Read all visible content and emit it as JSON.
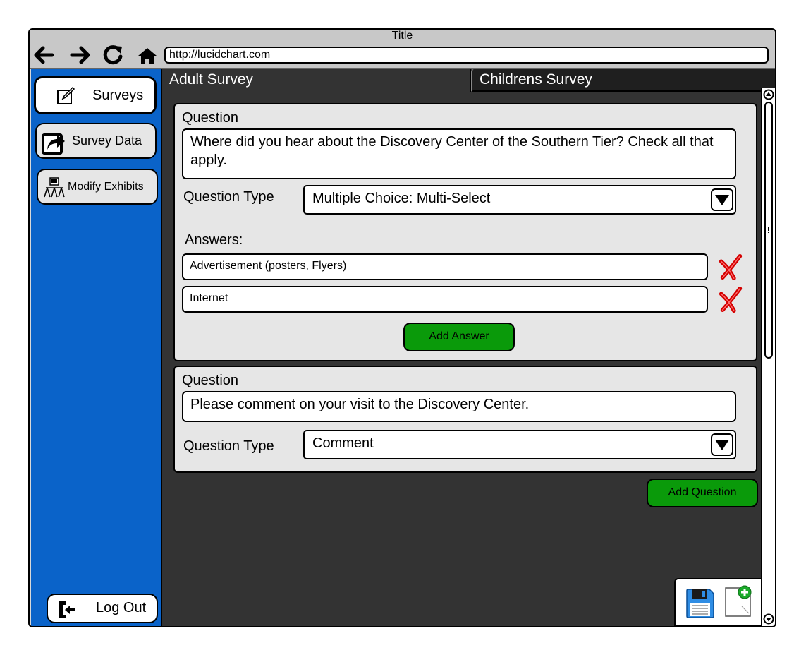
{
  "window": {
    "title": "Title",
    "url": "http://lucidchart.com"
  },
  "nav": {
    "back_icon": "arrow-left-icon",
    "forward_icon": "arrow-right-icon",
    "reload_icon": "reload-icon",
    "home_icon": "home-icon"
  },
  "sidebar": {
    "items": [
      {
        "label": "Surveys",
        "icon": "edit-icon",
        "selected": true
      },
      {
        "label": "Survey Data",
        "icon": "share-icon",
        "selected": false
      },
      {
        "label": "Modify Exhibits",
        "icon": "exhibit-icon",
        "selected": false
      }
    ],
    "logout_label": "Log Out"
  },
  "tabs": [
    {
      "label": "Adult Survey",
      "active": true
    },
    {
      "label": "Childrens Survey",
      "active": false
    }
  ],
  "questions": [
    {
      "label": "Question",
      "text": "Where did you hear about the Discovery Center of the Southern Tier? Check all that apply.",
      "type_label": "Question Type",
      "type_value": "Multiple Choice: Multi-Select",
      "answers_label": "Answers:",
      "answers": [
        "Advertisement (posters, Flyers)",
        "Internet"
      ],
      "add_answer_label": "Add Answer"
    },
    {
      "label": "Question",
      "text": "Please comment on your visit to the Discovery Center.",
      "type_label": "Question Type",
      "type_value": "Comment"
    }
  ],
  "add_question_label": "Add Question",
  "colors": {
    "sidebar": "#0a63c9",
    "panel": "#333333",
    "card": "#e6e6e6",
    "button_green": "#0a9a0a",
    "delete_red": "#d40000"
  }
}
